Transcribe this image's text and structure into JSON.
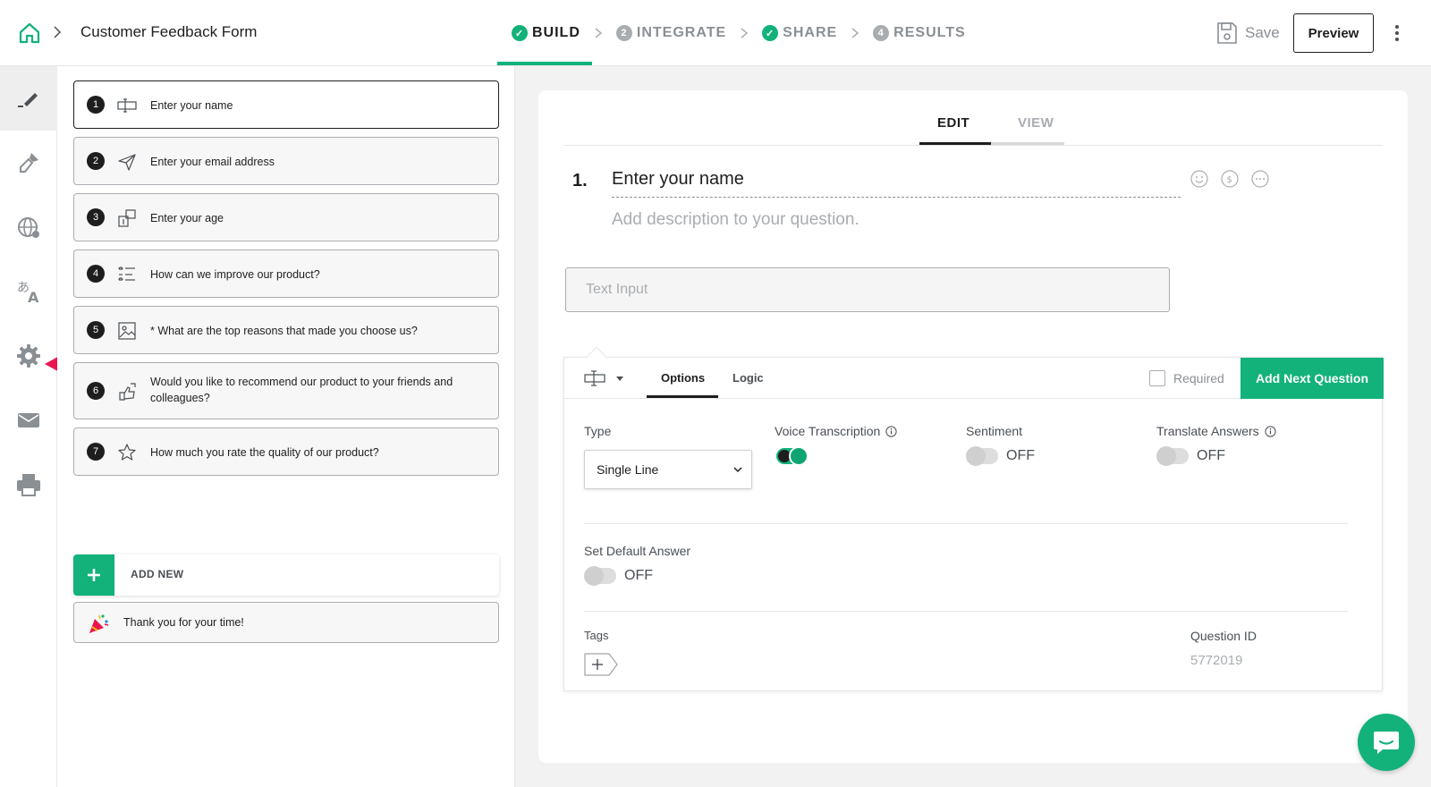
{
  "header": {
    "form_title": "Customer Feedback Form",
    "steps": [
      {
        "label": "BUILD",
        "status": "done"
      },
      {
        "label": "INTEGRATE",
        "status": "pending",
        "number": "2"
      },
      {
        "label": "SHARE",
        "status": "done"
      },
      {
        "label": "RESULTS",
        "status": "pending",
        "number": "4"
      }
    ],
    "save_label": "Save",
    "preview_label": "Preview"
  },
  "rail": {
    "items": [
      "pencil-icon",
      "paint-brush-icon",
      "globe-icon",
      "translate-icon",
      "gear-icon",
      "mail-icon",
      "printer-icon"
    ]
  },
  "questions": [
    {
      "number": "1",
      "icon": "text-input-icon",
      "text": "Enter your name"
    },
    {
      "number": "2",
      "icon": "send-icon",
      "text": "Enter your email address"
    },
    {
      "number": "3",
      "icon": "number-icon",
      "text": "Enter your age"
    },
    {
      "number": "4",
      "icon": "list-icon",
      "text": "How can we improve our product?"
    },
    {
      "number": "5",
      "icon": "image-icon",
      "text": "* What are the top reasons that made you choose us?"
    },
    {
      "number": "6",
      "icon": "recommend-icon",
      "text": "Would you like to recommend our product to your friends and colleagues?"
    },
    {
      "number": "7",
      "icon": "star-icon",
      "text": "How much you rate the quality of our product?"
    }
  ],
  "add_new_label": "ADD NEW",
  "thank_you_label": "Thank you for your time!",
  "editor": {
    "tabs": {
      "edit": "EDIT",
      "view": "VIEW"
    },
    "question_index": "1.",
    "question_title": "Enter your name",
    "description_placeholder": "Add description to your question.",
    "input_placeholder": "Text Input",
    "options_tab": "Options",
    "logic_tab": "Logic",
    "required_label": "Required",
    "add_next_label": "Add Next Question",
    "type_label": "Type",
    "type_value": "Single Line",
    "voice_label": "Voice Transcription",
    "sentiment_label": "Sentiment",
    "sentiment_state": "OFF",
    "translate_label": "Translate Answers",
    "translate_state": "OFF",
    "default_label": "Set Default Answer",
    "default_state": "OFF",
    "tags_label": "Tags",
    "question_id_label": "Question ID",
    "question_id_value": "5772019"
  },
  "colors": {
    "accent": "#12b27a",
    "arrow": "#e8174f"
  }
}
